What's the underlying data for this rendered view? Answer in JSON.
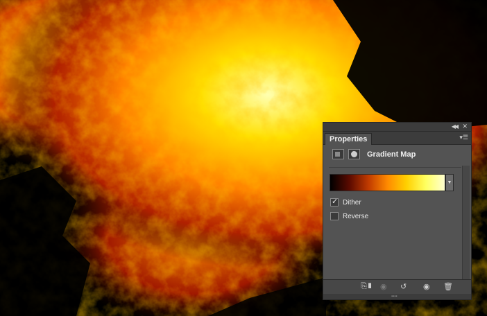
{
  "canvas": {
    "content": "fire-texture-image"
  },
  "panel": {
    "tab_label": "Properties",
    "adjustment_title": "Gradient Map",
    "gradient_colors": [
      "#000000",
      "#5a0a00",
      "#c03a00",
      "#ff8a00",
      "#ffd000",
      "#ffff60",
      "#ffffd0"
    ],
    "options": [
      {
        "label": "Dither",
        "checked": true
      },
      {
        "label": "Reverse",
        "checked": false
      }
    ],
    "icons": {
      "collapse": "double-chevron-left-icon",
      "close": "close-icon",
      "panel_menu": "panel-menu-icon",
      "adjustment": "gradient-map-adjustment-icon",
      "mask": "layer-mask-icon",
      "footer": [
        "clip-to-layer-icon",
        "view-previous-state-icon",
        "reset-icon",
        "visibility-icon",
        "delete-icon"
      ]
    }
  }
}
